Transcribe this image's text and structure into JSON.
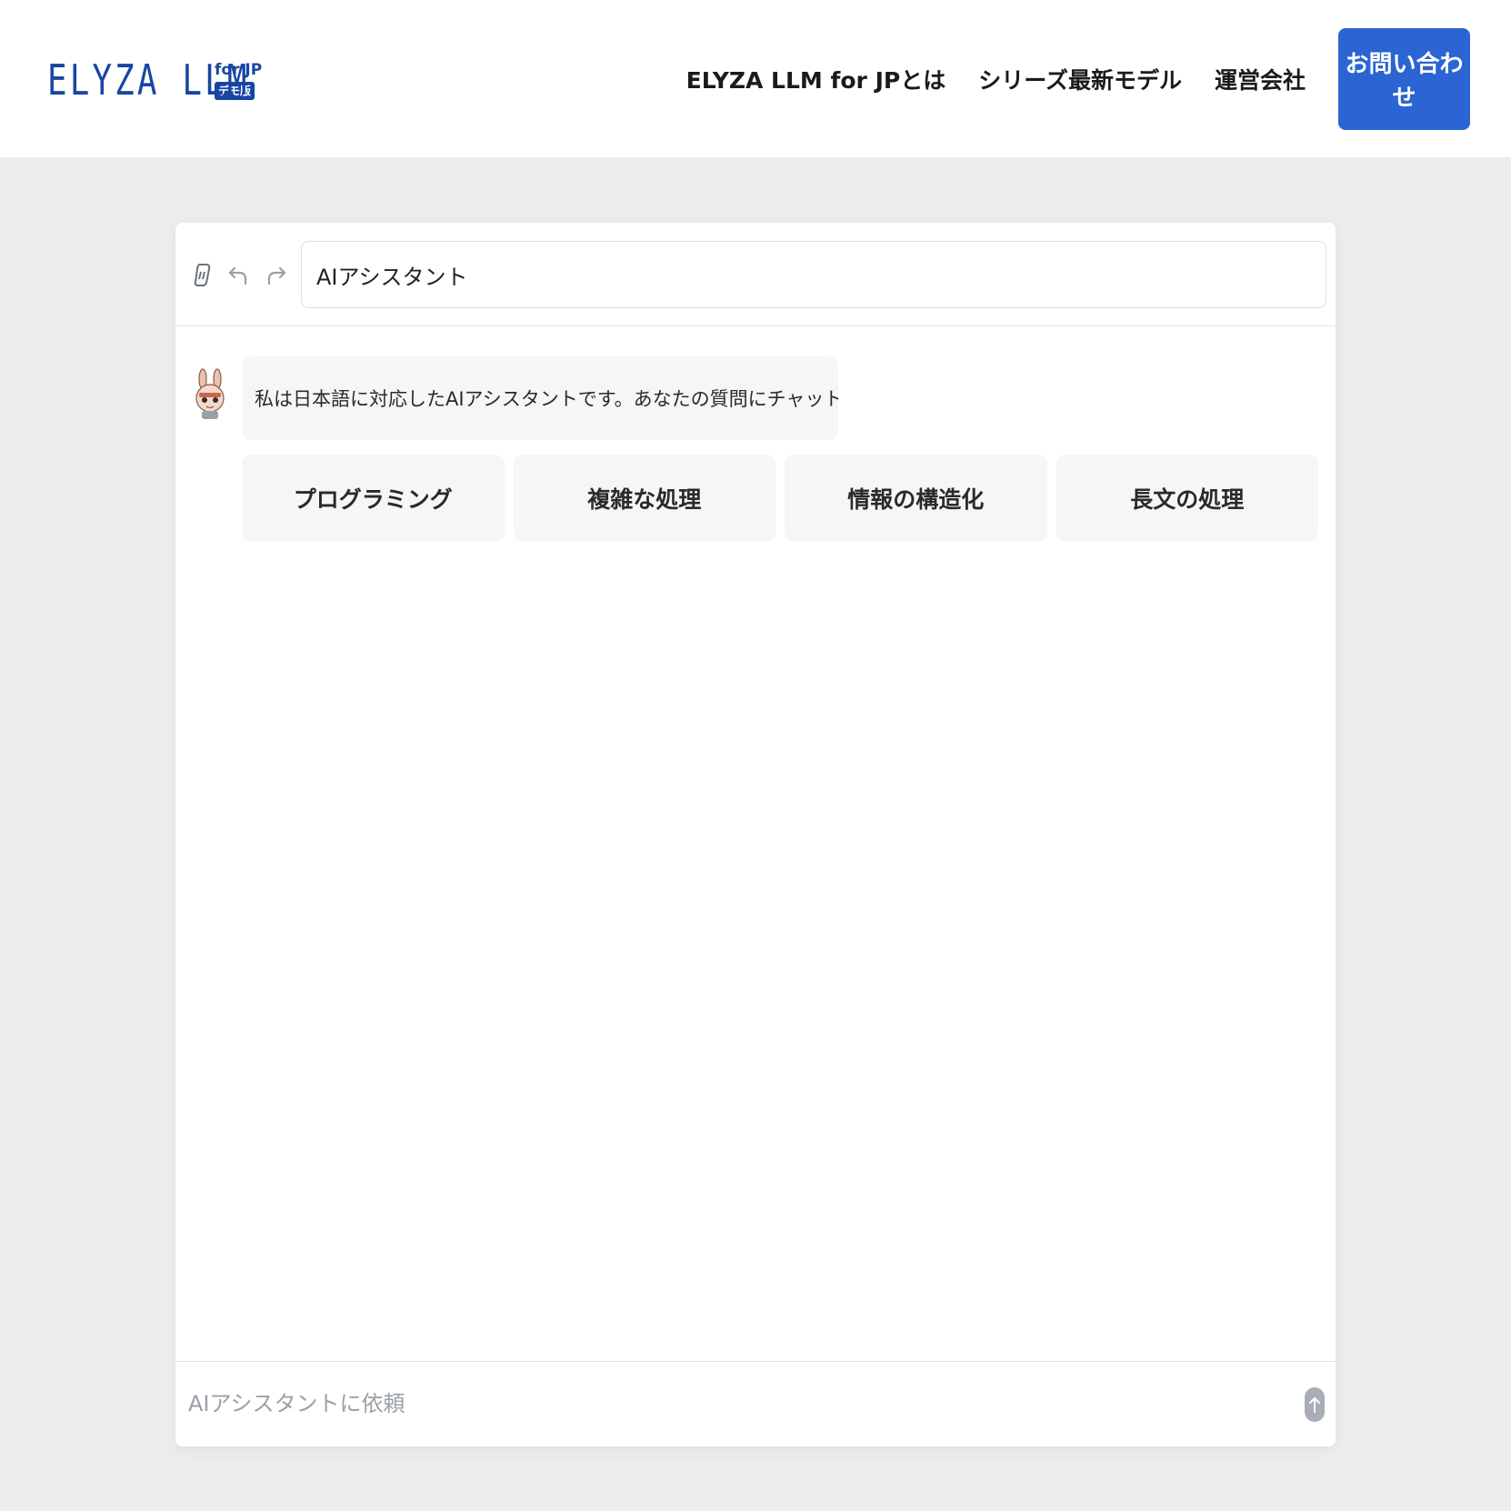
{
  "header": {
    "logo_main": "ELYZA LLM",
    "logo_for": "for JP",
    "logo_badge": "デモ版",
    "nav": [
      {
        "label": "ELYZA LLM for JPとは"
      },
      {
        "label": "シリーズ最新モデル"
      },
      {
        "label": "運営会社"
      }
    ],
    "contact_label": "お問い合わせ"
  },
  "toolbar": {
    "icons": [
      "clear-chat-icon",
      "undo-icon",
      "redo-icon"
    ],
    "title_value": "AIアシスタント"
  },
  "chat": {
    "assistant_message": "私は日本語に対応したAIアシスタントです。あなたの質問にチャット形式で回答します。",
    "suggestions": [
      {
        "label": "プログラミング"
      },
      {
        "label": "複雑な処理"
      },
      {
        "label": "情報の構造化"
      },
      {
        "label": "長文の処理"
      }
    ]
  },
  "composer": {
    "placeholder": "AIアシスタントに依頼"
  },
  "colors": {
    "brand": "#1746a2",
    "accent_button": "#2b64d3",
    "page_bg": "#ededed",
    "send_disabled": "#a9adb8"
  }
}
